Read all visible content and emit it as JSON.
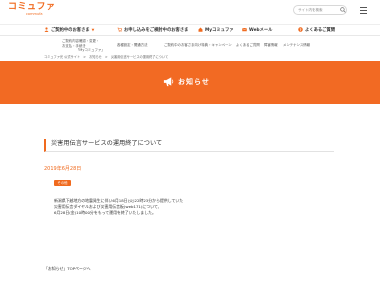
{
  "header": {
    "logo": "コミュファ",
    "logo_sub": "commufa",
    "search": {
      "placeholder": "サイト内を検索"
    },
    "menu_icon": "menu-icon"
  },
  "nav": {
    "items": [
      {
        "label": "ご契約中のお客さま",
        "icon": "person-icon"
      },
      {
        "label": "お申し込みをご検討中のお客さま",
        "icon": "cart-icon"
      },
      {
        "label": "Myコミュファ",
        "icon": "house-icon"
      },
      {
        "label": "Webメール",
        "icon": "mail-icon"
      },
      {
        "label": "よくあるご質問",
        "icon": "question-icon"
      }
    ]
  },
  "subnav": {
    "items": [
      {
        "line1": "ご契約内容確認・変更・",
        "line2": "お支払・手続き",
        "line3": "「Myコミュファ」"
      },
      {
        "line1": "各種設定・開通方法"
      },
      {
        "line1": "ご契約中のお客さま向け特典・キャンペーン"
      },
      {
        "line1": "よくあるご質問"
      },
      {
        "line1": "障害情報"
      },
      {
        "line1": "メンテナンス情報"
      }
    ]
  },
  "breadcrumb": "コミュファ光 公式サイト　>　お知らせ　>　災害用伝言サービスの運用終了について",
  "banner": {
    "title": "お知らせ",
    "icon": "megaphone-icon"
  },
  "article": {
    "title": "災害用伝言サービスの運用終了について",
    "date": "2019年6月28日",
    "badge": "その他",
    "body": [
      "新潟県下越地方の地震発生に伴い6月18日(火)22時23分から提供していた",
      "災害用伝言ダイヤルおよび災害用伝言板(web171)について、",
      "6月28日(金)10時00分をもって運用を終了いたしました。"
    ]
  },
  "back_link": "「お知らせ」TOPページへ"
}
